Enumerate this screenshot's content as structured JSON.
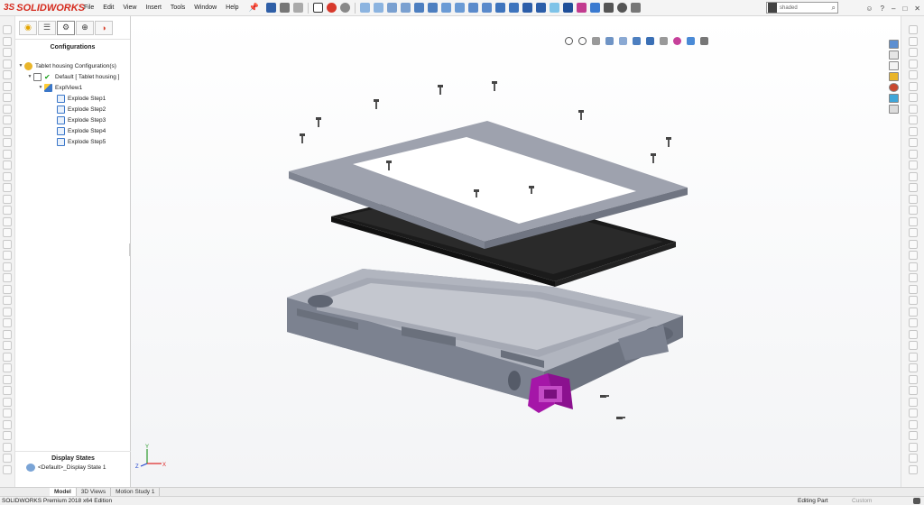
{
  "app": {
    "brand": "SOLIDWORKS",
    "brand_mark": "3S"
  },
  "menu": [
    "File",
    "Edit",
    "View",
    "Insert",
    "Tools",
    "Window",
    "Help"
  ],
  "search": {
    "value": "shaded",
    "icon": "search-icon"
  },
  "feature_manager": {
    "tabs": [
      "feature-manager-icon",
      "property-manager-icon",
      "configuration-manager-icon",
      "dimxpert-icon",
      "display-manager-icon"
    ],
    "active_tab": 2,
    "title": "Configurations",
    "tree": [
      {
        "label": "Tablet housing Configuration(s)",
        "level": 0,
        "icon": "configuration-icon",
        "expanded": true
      },
      {
        "label": "Default [ Tablet housing ]",
        "level": 1,
        "icon": "configuration-default-icon",
        "checked": true,
        "expanded": true
      },
      {
        "label": "ExplView1",
        "level": 2,
        "icon": "exploded-view-icon",
        "expanded": true
      },
      {
        "label": "Explode Step1",
        "level": 3,
        "icon": "explode-step-icon"
      },
      {
        "label": "Explode Step2",
        "level": 3,
        "icon": "explode-step-icon"
      },
      {
        "label": "Explode Step3",
        "level": 3,
        "icon": "explode-step-icon"
      },
      {
        "label": "Explode Step4",
        "level": 3,
        "icon": "explode-step-icon"
      },
      {
        "label": "Explode Step5",
        "level": 3,
        "icon": "explode-step-icon"
      }
    ],
    "display_states_title": "Display States",
    "display_state": "<Default>_Display State 1"
  },
  "triad": {
    "x": "X",
    "y": "Y",
    "z": "Z"
  },
  "bottom_tabs": [
    {
      "label": "Model",
      "active": true
    },
    {
      "label": "3D Views",
      "active": false
    },
    {
      "label": "Motion Study 1",
      "active": false
    }
  ],
  "status": {
    "edition": "SOLIDWORKS Premium 2018 x64 Edition",
    "mode": "Editing Part",
    "units": "Custom"
  },
  "colors": {
    "accent": "#d52b1e",
    "part_gray": "#9aa0ad",
    "connector_purple": "#a516a8",
    "screen_black": "#1b1b1b"
  }
}
